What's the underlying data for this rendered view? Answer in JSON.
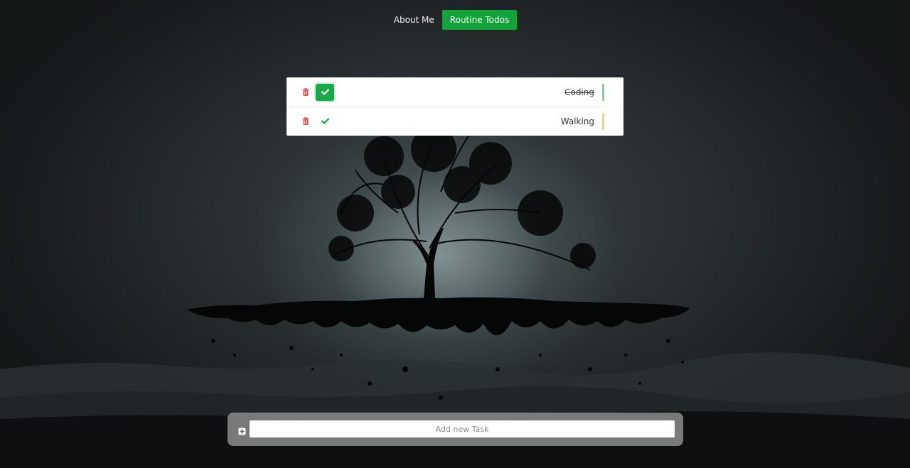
{
  "nav": {
    "items": [
      {
        "label": "About Me",
        "active": false
      },
      {
        "label": "Routine Todos",
        "active": true
      }
    ],
    "active_color": "#14a33b"
  },
  "todos": [
    {
      "label": "Coding",
      "completed": true,
      "priority_color": "#7cd39a"
    },
    {
      "label": "Walking",
      "completed": false,
      "priority_color": "#f3d27a"
    }
  ],
  "add_task": {
    "placeholder": "Add new Task",
    "icon": "plus-square-icon"
  },
  "icons": {
    "delete": "trash-icon",
    "complete": "check-icon"
  },
  "colors": {
    "delete": "#d9534f",
    "check_active_bg": "#17a94a",
    "check": "#17a94a"
  }
}
